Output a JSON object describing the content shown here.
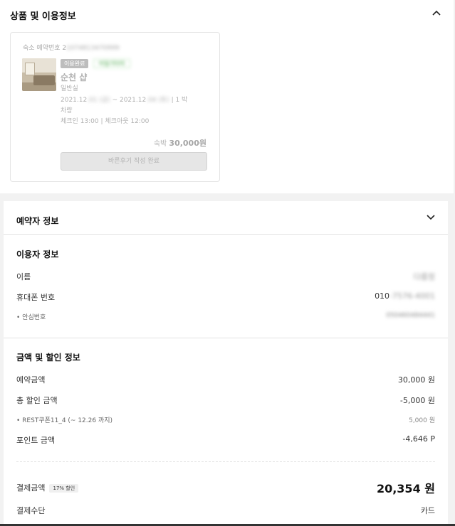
{
  "product_section": {
    "title": "상품 및 이용정보",
    "booking_no_label": "숙소 예약번호 2",
    "booking_no_masked": "1074813470999",
    "badge_status": "이용완료",
    "badge_extra": "아일기타미",
    "hotel_name": "순천 샵",
    "room_type": "일반실",
    "date_start": "2021.12",
    "date_start_masked": ".01 (금)",
    "date_sep": "~ 2021.12",
    "date_end_masked": ".04 (토)",
    "nights": "| 1 박",
    "vehicle": "차량",
    "checkin": "체크인 13:00 | 체크아웃 12:00",
    "price_label": "숙박",
    "price_value": "30,000원",
    "review_button": "바른후기 작성 완료"
  },
  "booker_section": {
    "title": "예약자 정보",
    "user_info_title": "이용자 정보",
    "name_label": "이름",
    "name_value_masked": "다름정",
    "phone_label": "휴대폰 번호",
    "phone_value": "010",
    "phone_value_masked": "-7576-4001",
    "safe_no_label": "• 안심번호",
    "safe_no_masked": "050460484441"
  },
  "payment_section": {
    "title": "금액 및 할인 정보",
    "rows": {
      "reserve_label": "예약금액",
      "reserve_value": "30,000 원",
      "discount_label": "총 할인 금액",
      "discount_value": "-5,000 원",
      "coupon_label": "• REST쿠폰11_4 (~ 12.26 까지)",
      "coupon_value": "5,000 원",
      "point_label": "포인트 금액",
      "point_value": "-4,646 P"
    },
    "total_label": "결제금액",
    "total_badge": "17% 할인",
    "total_value": "20,354 원",
    "method_label": "결제수단",
    "method_value": "카드"
  }
}
